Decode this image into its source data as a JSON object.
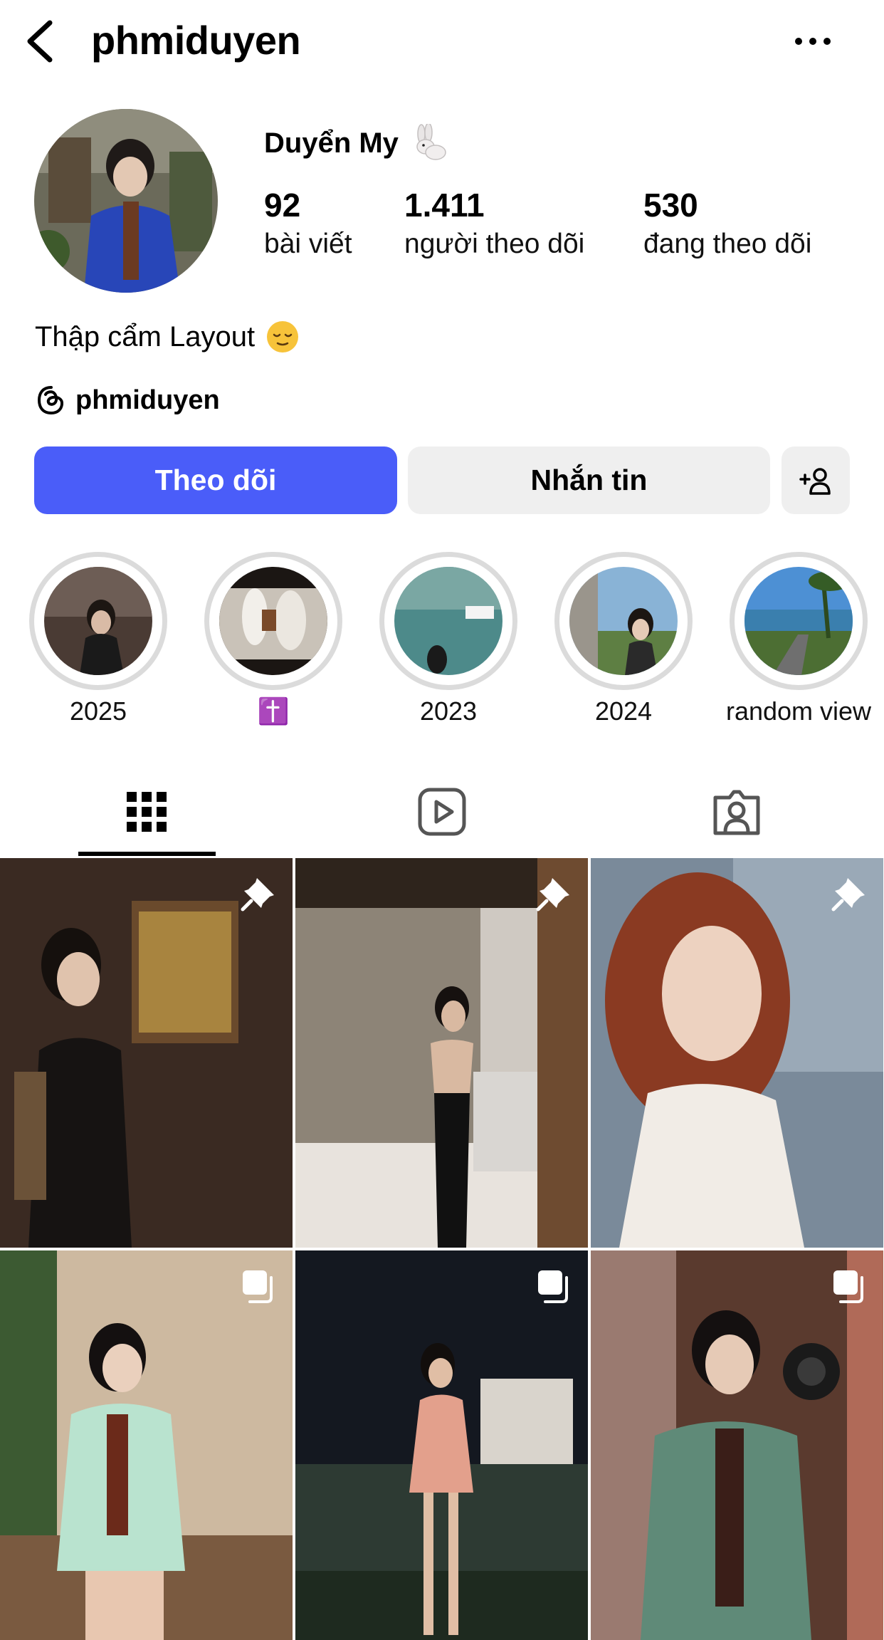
{
  "header": {
    "username": "phmiduyen"
  },
  "profile": {
    "full_name": "Duyển My",
    "stats": [
      {
        "value": "92",
        "label": "bài viết"
      },
      {
        "value": "1.411",
        "label": "người theo dõi"
      },
      {
        "value": "530",
        "label": "đang theo dõi"
      }
    ],
    "bio": "Thập cẩm Layout",
    "threads_handle": "phmiduyen"
  },
  "buttons": {
    "follow": "Theo dõi",
    "message": "Nhắn tin"
  },
  "highlights": [
    {
      "label": "2025"
    },
    {
      "label": "✝️"
    },
    {
      "label": "2023"
    },
    {
      "label": "2024"
    },
    {
      "label": "random view"
    }
  ],
  "tabs": [
    {
      "icon": "grid-icon",
      "active": true
    },
    {
      "icon": "reels-icon",
      "active": false
    },
    {
      "icon": "tagged-icon",
      "active": false
    }
  ],
  "posts": [
    {
      "badge": "pin-icon"
    },
    {
      "badge": "pin-icon"
    },
    {
      "badge": "pin-icon"
    },
    {
      "badge": "carousel-icon"
    },
    {
      "badge": "carousel-icon"
    },
    {
      "badge": "carousel-icon"
    }
  ],
  "colors": {
    "follow_button": "#4a5df9",
    "secondary_button": "#efefef",
    "highlight_ring": "#dbdbdb"
  }
}
